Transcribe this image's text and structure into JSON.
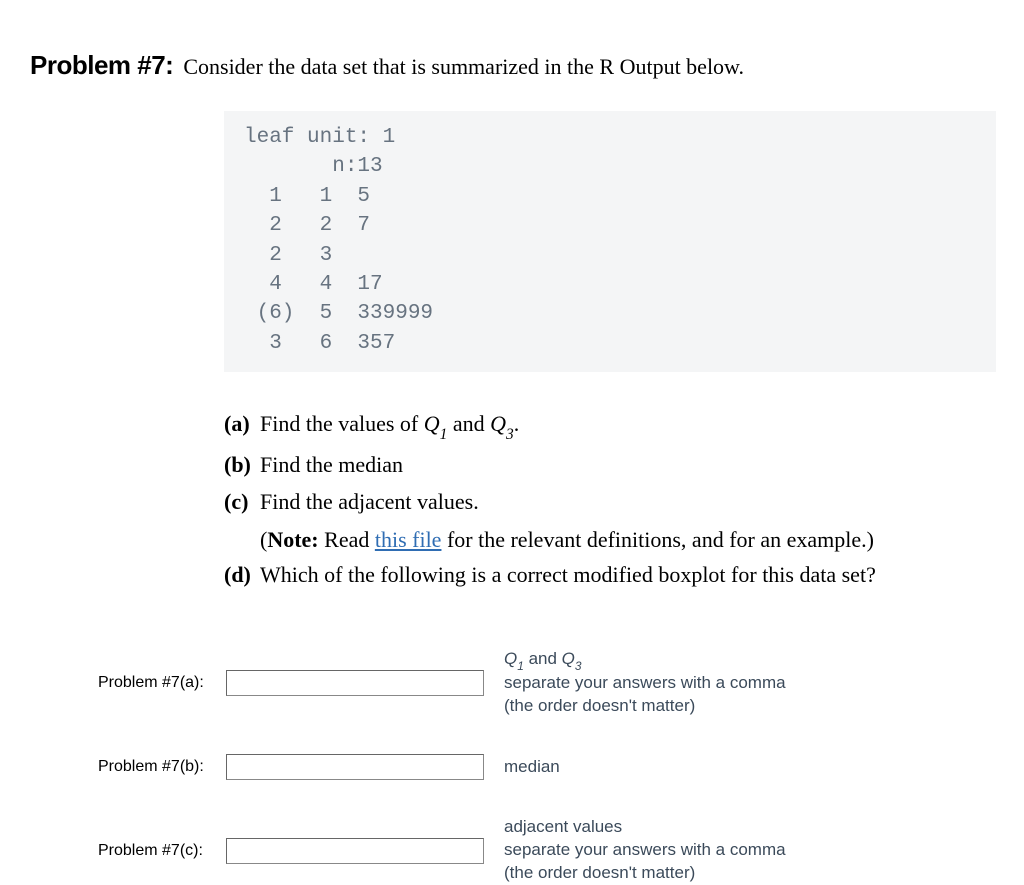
{
  "header": {
    "label": "Problem #7:",
    "prompt": "Consider the data set that is summarized in the R Output below."
  },
  "code": {
    "lines": [
      "leaf unit: 1",
      "       n:13",
      "  1   1  5",
      "  2   2  7",
      "  2   3",
      "  4   4  17",
      " (6)  5  339999",
      "  3   6  357"
    ]
  },
  "parts": {
    "a": {
      "label": "(a)",
      "text_before": "Find the values of ",
      "q1": "Q",
      "sub1": "1",
      "mid": " and ",
      "q3": "Q",
      "sub3": "3",
      "after": "."
    },
    "b": {
      "label": "(b)",
      "text": "Find the median"
    },
    "c": {
      "label": "(c)",
      "text": "Find the adjacent values.",
      "note_prefix": "(",
      "note_bold": "Note:",
      "note_mid": " Read ",
      "link": "this file",
      "note_after": " for the relevant definitions, and for an example.)"
    },
    "d": {
      "label": "(d)",
      "text": "Which of the following is a correct modified boxplot for this data set?"
    }
  },
  "answers": {
    "a": {
      "label": "Problem #7(a):",
      "hint_q": "Q",
      "hint_sub1": "1",
      "hint_mid": " and ",
      "hint_q2": "Q",
      "hint_sub3": "3",
      "hint_line2": "separate your answers with a comma",
      "hint_line3": "(the order doesn't matter)"
    },
    "b": {
      "label": "Problem #7(b):",
      "hint": "median"
    },
    "c": {
      "label": "Problem #7(c):",
      "hint_line1": "adjacent values",
      "hint_line2": "separate your answers with a comma",
      "hint_line3": "(the order doesn't matter)"
    }
  }
}
